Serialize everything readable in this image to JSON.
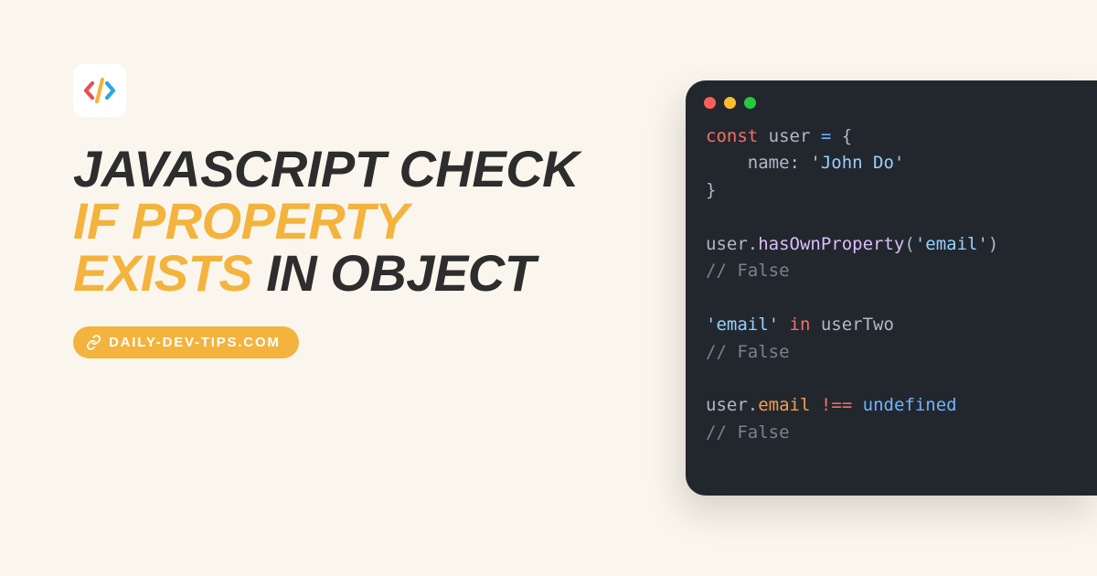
{
  "headline": {
    "part1": "JAVASCRIPT CHECK ",
    "part2": "IF PROPERTY EXISTS",
    "part3": " IN OBJECT"
  },
  "pill": {
    "label": "DAILY-DEV-TIPS.COM"
  },
  "colors": {
    "accent": "#f3b33d",
    "code_bg": "#22272e",
    "page_bg": "#fbf6ed"
  },
  "traffic_lights": [
    "#ff5f56",
    "#ffbd2e",
    "#27c93f"
  ],
  "code": {
    "lines": [
      [
        {
          "t": "const",
          "c": "kw"
        },
        {
          "t": " user ",
          "c": "var"
        },
        {
          "t": "=",
          "c": "blue"
        },
        {
          "t": " {",
          "c": "var"
        }
      ],
      [
        {
          "t": "    name",
          "c": "var"
        },
        {
          "t": ":",
          "c": "var"
        },
        {
          "t": " ",
          "c": "var"
        },
        {
          "t": "'John Do'",
          "c": "str"
        }
      ],
      [
        {
          "t": "}",
          "c": "var"
        }
      ],
      [],
      [
        {
          "t": "user",
          "c": "var"
        },
        {
          "t": ".",
          "c": "var"
        },
        {
          "t": "hasOwnProperty",
          "c": "fn"
        },
        {
          "t": "(",
          "c": "var"
        },
        {
          "t": "'email'",
          "c": "str"
        },
        {
          "t": ")",
          "c": "var"
        }
      ],
      [
        {
          "t": "// False",
          "c": "comment"
        }
      ],
      [],
      [
        {
          "t": "'email'",
          "c": "str"
        },
        {
          "t": " ",
          "c": "var"
        },
        {
          "t": "in",
          "c": "kw"
        },
        {
          "t": " userTwo",
          "c": "var"
        }
      ],
      [
        {
          "t": "// False",
          "c": "comment"
        }
      ],
      [],
      [
        {
          "t": "user",
          "c": "var"
        },
        {
          "t": ".",
          "c": "var"
        },
        {
          "t": "email",
          "c": "prop"
        },
        {
          "t": " ",
          "c": "var"
        },
        {
          "t": "!==",
          "c": "kw"
        },
        {
          "t": " ",
          "c": "var"
        },
        {
          "t": "undefined",
          "c": "undef"
        }
      ],
      [
        {
          "t": "// False",
          "c": "comment"
        }
      ]
    ]
  }
}
